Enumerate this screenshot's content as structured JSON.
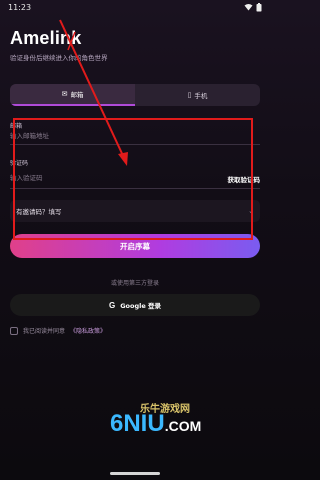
{
  "status_bar": {
    "time": "11:23"
  },
  "app": {
    "title": "Amelink",
    "subtitle": "验证身份后继续进入你的角色世界"
  },
  "tabs": [
    {
      "label": "邮箱",
      "icon": "mail-icon",
      "active": true
    },
    {
      "label": "手机",
      "icon": "phone-icon",
      "active": false
    }
  ],
  "form": {
    "email_label": "邮箱",
    "email_placeholder": "输入邮箱地址",
    "code_label": "验证码",
    "code_placeholder": "输入验证码",
    "get_code": "获取验证码",
    "invite_label": "有邀请码？填写",
    "submit": "开启序幕"
  },
  "third_party": {
    "divider": "或使用第三方登录",
    "google_label": "Google 登录"
  },
  "agreement": {
    "prefix": "我已阅读并同意",
    "link": "《隐私政策》"
  },
  "watermark": {
    "cn": "乐牛游戏网",
    "logo": "6NIU",
    "com": ".COM"
  },
  "colors": {
    "accent": "#b04bd8",
    "annotation_red": "#e11b1b"
  }
}
